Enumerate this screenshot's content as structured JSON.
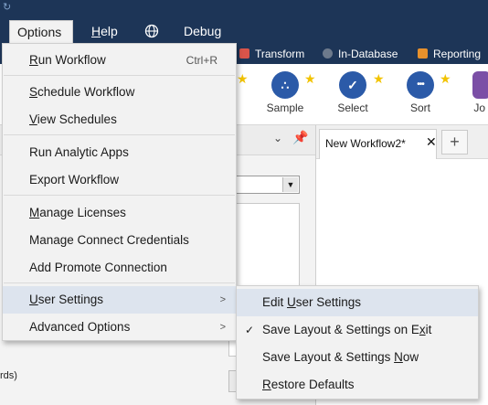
{
  "menubar": {
    "items": [
      "Options",
      "Help",
      "",
      "Debug"
    ]
  },
  "categories": [
    {
      "label": "Transform",
      "color": "#d9544a"
    },
    {
      "label": "In-Database",
      "color": "#6d7a8c"
    },
    {
      "label": "Reporting",
      "color": "#e8912c"
    }
  ],
  "tools": [
    {
      "label": "Sample",
      "glyph": "∴"
    },
    {
      "label": "Select",
      "glyph": "✓"
    },
    {
      "label": "Sort",
      "glyph": "•••"
    },
    {
      "label": "Jo",
      "glyph": ""
    }
  ],
  "left_panel": {
    "footer_text": "rds)"
  },
  "workflow_tab": {
    "title": "New Workflow2*",
    "close": "✕",
    "add": "+"
  },
  "options_menu": {
    "run_workflow": "Run Workflow",
    "run_workflow_shortcut": "Ctrl+R",
    "schedule_workflow": "Schedule Workflow",
    "view_schedules": "View Schedules",
    "run_analytic_apps": "Run Analytic Apps",
    "export_workflow": "Export Workflow",
    "manage_licenses": "Manage Licenses",
    "manage_connect_credentials": "Manage Connect Credentials",
    "add_promote_connection": "Add Promote Connection",
    "user_settings": "User Settings",
    "advanced_options": "Advanced Options"
  },
  "user_settings_submenu": {
    "edit_user_settings": "Edit User Settings",
    "save_layout_on_exit": "Save Layout & Settings on Exit",
    "save_layout_on_exit_checked": true,
    "save_layout_now": "Save Layout & Settings Now",
    "restore_defaults": "Restore Defaults"
  }
}
